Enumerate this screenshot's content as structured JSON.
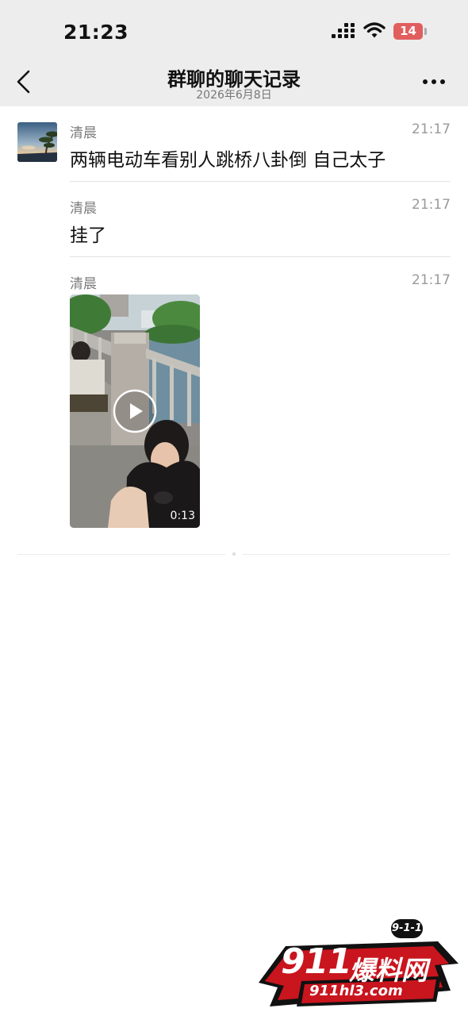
{
  "status_bar": {
    "time": "21:23",
    "battery": "14"
  },
  "nav": {
    "title": "群聊的聊天记录",
    "date": "2026年6月8日"
  },
  "messages": [
    {
      "sender": "清晨",
      "time": "21:17",
      "text": "两辆电动车看别人跳桥八卦倒 自己太子"
    },
    {
      "sender": "清晨",
      "time": "21:17",
      "text": "挂了"
    },
    {
      "sender": "清晨",
      "time": "21:17",
      "video_duration": "0:13"
    }
  ],
  "watermark": {
    "number": "911",
    "name": "爆料网",
    "url": "911hl3.com",
    "badge": "9-1-1"
  },
  "colors": {
    "header_bg": "#ededed",
    "battery_low": "#e25d5d",
    "watermark_red": "#c9151e"
  }
}
